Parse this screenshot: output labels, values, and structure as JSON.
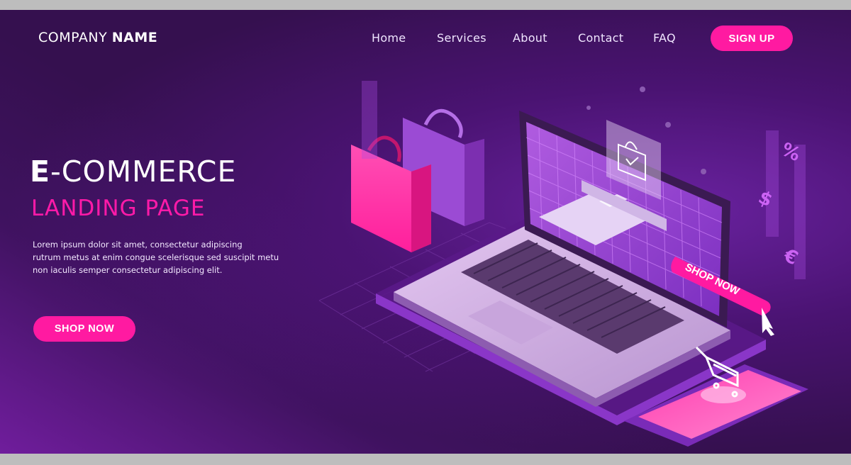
{
  "brand": {
    "light": "COMPANY ",
    "bold": "NAME"
  },
  "nav": {
    "items": [
      "Home",
      "Services",
      "About",
      "Contact",
      "FAQ"
    ],
    "signup": "SIGN UP"
  },
  "hero": {
    "title_first": "E",
    "title_rest": "-COMMERCE",
    "subtitle": "LANDING PAGE",
    "body_lines": [
      "Lorem ipsum dolor sit amet, consectetur adipiscing",
      "rutrum metus at enim congue scelerisque sed suscipit metu",
      "non iaculis semper consectetur adipiscing elit."
    ],
    "cta": "SHOP NOW"
  },
  "illustration": {
    "screen_button": "SHOP NOW",
    "currency": {
      "percent": "%",
      "dollar": "$",
      "euro": "€"
    }
  },
  "colors": {
    "accent": "#ff1aa1",
    "background": "#3a1156",
    "violet": "#8a2be2"
  }
}
